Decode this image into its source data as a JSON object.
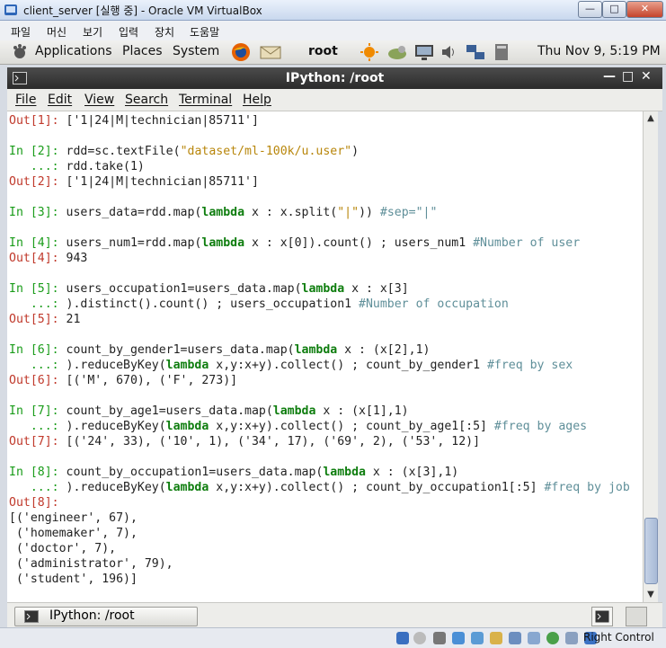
{
  "vbox": {
    "title": "client_server [실행 중] - Oracle VM VirtualBox",
    "menu": [
      "파일",
      "머신",
      "보기",
      "입력",
      "장치",
      "도움말"
    ],
    "host_key": "Right Control"
  },
  "panel": {
    "applications": "Applications",
    "places": "Places",
    "system": "System",
    "user": "root",
    "clock": "Thu Nov  9,  5:19 PM"
  },
  "terminal": {
    "title": "IPython: /root",
    "menu": [
      "File",
      "Edit",
      "View",
      "Search",
      "Terminal",
      "Help"
    ],
    "taskbar_label": "IPython: /root"
  },
  "session": [
    {
      "type": "out",
      "prompt": "Out[1]:",
      "segs": [
        {
          "t": "plain",
          "v": " ['1|24|M|technician|85711']"
        }
      ]
    },
    {
      "type": "blank"
    },
    {
      "type": "in",
      "prompt": "In [2]:",
      "segs": [
        {
          "t": "plain",
          "v": " rdd=sc.textFile("
        },
        {
          "t": "str",
          "v": "\"dataset/ml-100k/u.user\""
        },
        {
          "t": "plain",
          "v": ")"
        }
      ]
    },
    {
      "type": "cont",
      "prompt": "   ...:",
      "segs": [
        {
          "t": "plain",
          "v": " rdd.take(1)"
        }
      ]
    },
    {
      "type": "out",
      "prompt": "Out[2]:",
      "segs": [
        {
          "t": "plain",
          "v": " ['1|24|M|technician|85711']"
        }
      ]
    },
    {
      "type": "blank"
    },
    {
      "type": "in",
      "prompt": "In [3]:",
      "segs": [
        {
          "t": "plain",
          "v": " users_data=rdd.map("
        },
        {
          "t": "kw",
          "v": "lambda"
        },
        {
          "t": "plain",
          "v": " x : x.split("
        },
        {
          "t": "str",
          "v": "\"|\""
        },
        {
          "t": "plain",
          "v": ")) "
        },
        {
          "t": "cmt",
          "v": "#sep=\"|\""
        }
      ]
    },
    {
      "type": "blank"
    },
    {
      "type": "in",
      "prompt": "In [4]:",
      "segs": [
        {
          "t": "plain",
          "v": " users_num1=rdd.map("
        },
        {
          "t": "kw",
          "v": "lambda"
        },
        {
          "t": "plain",
          "v": " x : x[0]).count() ; users_num1 "
        },
        {
          "t": "cmt",
          "v": "#Number of user"
        }
      ]
    },
    {
      "type": "out",
      "prompt": "Out[4]:",
      "segs": [
        {
          "t": "plain",
          "v": " 943"
        }
      ]
    },
    {
      "type": "blank"
    },
    {
      "type": "in",
      "prompt": "In [5]:",
      "segs": [
        {
          "t": "plain",
          "v": " users_occupation1=users_data.map("
        },
        {
          "t": "kw",
          "v": "lambda"
        },
        {
          "t": "plain",
          "v": " x : x[3]"
        }
      ]
    },
    {
      "type": "cont",
      "prompt": "   ...:",
      "segs": [
        {
          "t": "plain",
          "v": " ).distinct().count() ; users_occupation1 "
        },
        {
          "t": "cmt",
          "v": "#Number of occupation"
        }
      ]
    },
    {
      "type": "out",
      "prompt": "Out[5]:",
      "segs": [
        {
          "t": "plain",
          "v": " 21"
        }
      ]
    },
    {
      "type": "blank"
    },
    {
      "type": "in",
      "prompt": "In [6]:",
      "segs": [
        {
          "t": "plain",
          "v": " count_by_gender1=users_data.map("
        },
        {
          "t": "kw",
          "v": "lambda"
        },
        {
          "t": "plain",
          "v": " x : (x[2],1)"
        }
      ]
    },
    {
      "type": "cont",
      "prompt": "   ...:",
      "segs": [
        {
          "t": "plain",
          "v": " ).reduceByKey("
        },
        {
          "t": "kw",
          "v": "lambda"
        },
        {
          "t": "plain",
          "v": " x,y:x+y).collect() ; count_by_gender1 "
        },
        {
          "t": "cmt",
          "v": "#freq by sex"
        }
      ]
    },
    {
      "type": "out",
      "prompt": "Out[6]:",
      "segs": [
        {
          "t": "plain",
          "v": " [('M', 670), ('F', 273)]"
        }
      ]
    },
    {
      "type": "blank"
    },
    {
      "type": "in",
      "prompt": "In [7]:",
      "segs": [
        {
          "t": "plain",
          "v": " count_by_age1=users_data.map("
        },
        {
          "t": "kw",
          "v": "lambda"
        },
        {
          "t": "plain",
          "v": " x : (x[1],1)"
        }
      ]
    },
    {
      "type": "cont",
      "prompt": "   ...:",
      "segs": [
        {
          "t": "plain",
          "v": " ).reduceByKey("
        },
        {
          "t": "kw",
          "v": "lambda"
        },
        {
          "t": "plain",
          "v": " x,y:x+y).collect() ; count_by_age1[:5] "
        },
        {
          "t": "cmt",
          "v": "#freq by ages"
        }
      ]
    },
    {
      "type": "out",
      "prompt": "Out[7]:",
      "segs": [
        {
          "t": "plain",
          "v": " [('24', 33), ('10', 1), ('34', 17), ('69', 2), ('53', 12)]"
        }
      ]
    },
    {
      "type": "blank"
    },
    {
      "type": "in",
      "prompt": "In [8]:",
      "segs": [
        {
          "t": "plain",
          "v": " count_by_occupation1=users_data.map("
        },
        {
          "t": "kw",
          "v": "lambda"
        },
        {
          "t": "plain",
          "v": " x : (x[3],1)"
        }
      ]
    },
    {
      "type": "cont",
      "prompt": "   ...:",
      "segs": [
        {
          "t": "plain",
          "v": " ).reduceByKey("
        },
        {
          "t": "kw",
          "v": "lambda"
        },
        {
          "t": "plain",
          "v": " x,y:x+y).collect() ; count_by_occupation1[:5] "
        },
        {
          "t": "cmt",
          "v": "#freq by job"
        }
      ]
    },
    {
      "type": "out",
      "prompt": "Out[8]:",
      "segs": []
    },
    {
      "type": "plain",
      "prompt": "",
      "segs": [
        {
          "t": "plain",
          "v": "[('engineer', 67),"
        }
      ]
    },
    {
      "type": "plain",
      "prompt": "",
      "segs": [
        {
          "t": "plain",
          "v": " ('homemaker', 7),"
        }
      ]
    },
    {
      "type": "plain",
      "prompt": "",
      "segs": [
        {
          "t": "plain",
          "v": " ('doctor', 7),"
        }
      ]
    },
    {
      "type": "plain",
      "prompt": "",
      "segs": [
        {
          "t": "plain",
          "v": " ('administrator', 79),"
        }
      ]
    },
    {
      "type": "plain",
      "prompt": "",
      "segs": [
        {
          "t": "plain",
          "v": " ('student', 196)]"
        }
      ]
    }
  ],
  "colors": {
    "prompt_in": "#1a9c1a",
    "prompt_out": "#c0392b",
    "keyword": "#0e7d0e",
    "string": "#b8860b",
    "comment": "#5f8f99"
  }
}
